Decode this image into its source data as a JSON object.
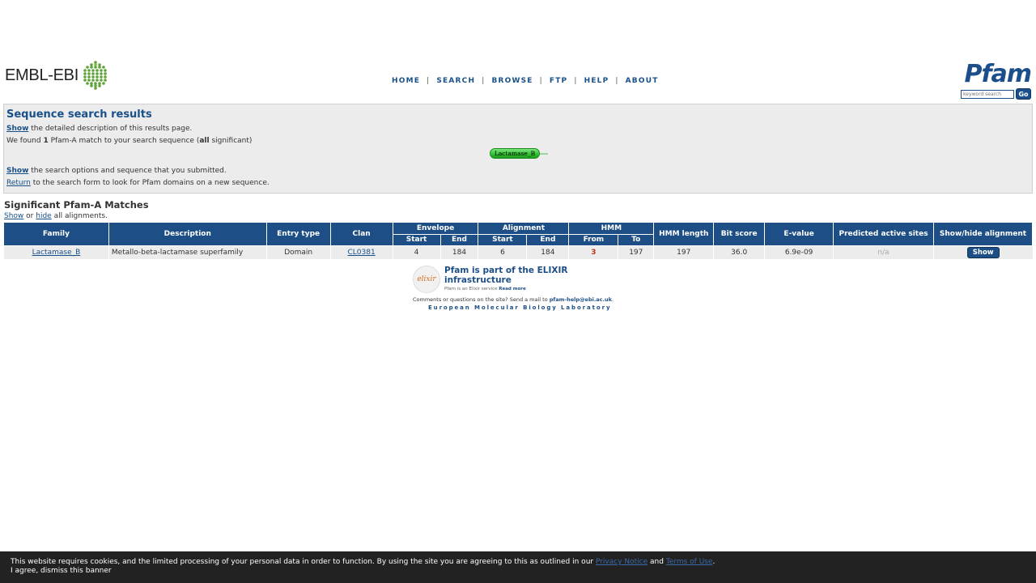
{
  "header": {
    "ebi_logo_text": "EMBL-EBI",
    "nav": [
      "HOME",
      "SEARCH",
      "BROWSE",
      "FTP",
      "HELP",
      "ABOUT"
    ],
    "nav_separator": "|",
    "pfam_logo": "Pfam",
    "keyword_placeholder": "keyword search",
    "go_label": "Go",
    "brand_color": "#1b4f8c"
  },
  "results": {
    "title": "Sequence search results",
    "show_desc_link": "Show",
    "show_desc_text": " the detailed description of this results page.",
    "found_prefix": "We found ",
    "found_count": "1",
    "found_mid": " Pfam-A match to your search sequence (",
    "found_all": "all",
    "found_suffix": " significant)",
    "domain_label": "Lactamase_B",
    "show_options_link": "Show",
    "show_options_text": " the search options and sequence that you submitted.",
    "return_link": "Return",
    "return_text": " to the search form to look for Pfam domains on a new sequence."
  },
  "matches": {
    "title": "Significant Pfam-A Matches",
    "show_link": "Show",
    "or_text": " or ",
    "hide_link": "hide",
    "all_text": " all alignments.",
    "headers": {
      "family": "Family",
      "description": "Description",
      "entry_type": "Entry type",
      "clan": "Clan",
      "envelope": "Envelope",
      "alignment": "Alignment",
      "hmm": "HMM",
      "hmm_length": "HMM length",
      "bit_score": "Bit score",
      "evalue": "E-value",
      "predicted": "Predicted active sites",
      "showhide": "Show/hide alignment",
      "start": "Start",
      "end": "End",
      "from": "From",
      "to": "To"
    },
    "rows": [
      {
        "family": "Lactamase_B",
        "description": "Metallo-beta-lactamase superfamily",
        "entry_type": "Domain",
        "clan": "CL0381",
        "env_start": "4",
        "env_end": "184",
        "ali_start": "6",
        "ali_end": "184",
        "hmm_from": "3",
        "hmm_to": "197",
        "hmm_length": "197",
        "bit_score": "36.0",
        "evalue": "6.9e-09",
        "predicted": "n/a",
        "button": "Show"
      }
    ]
  },
  "footer": {
    "elixir_logo": "elixir",
    "elixir_title_1": "Pfam is part of the ELIXIR",
    "elixir_title_2": "infrastructure",
    "elixir_sub": "Pfam is an Elixir service ",
    "elixir_readmore": "Read more",
    "contact_text": "Comments or questions on the site? Send a mail to ",
    "contact_email": "pfam-help@ebi.ac.uk",
    "contact_end": ".",
    "embl": "European Molecular Biology Laboratory"
  },
  "cookie": {
    "text": "This website requires cookies, and the limited processing of your personal data in order to function. By using the site you are agreeing to this as outlined in our ",
    "privacy": "Privacy Notice",
    "and": " and ",
    "terms": "Terms of Use",
    "end": ".",
    "dismiss": "I agree, dismiss this banner"
  }
}
